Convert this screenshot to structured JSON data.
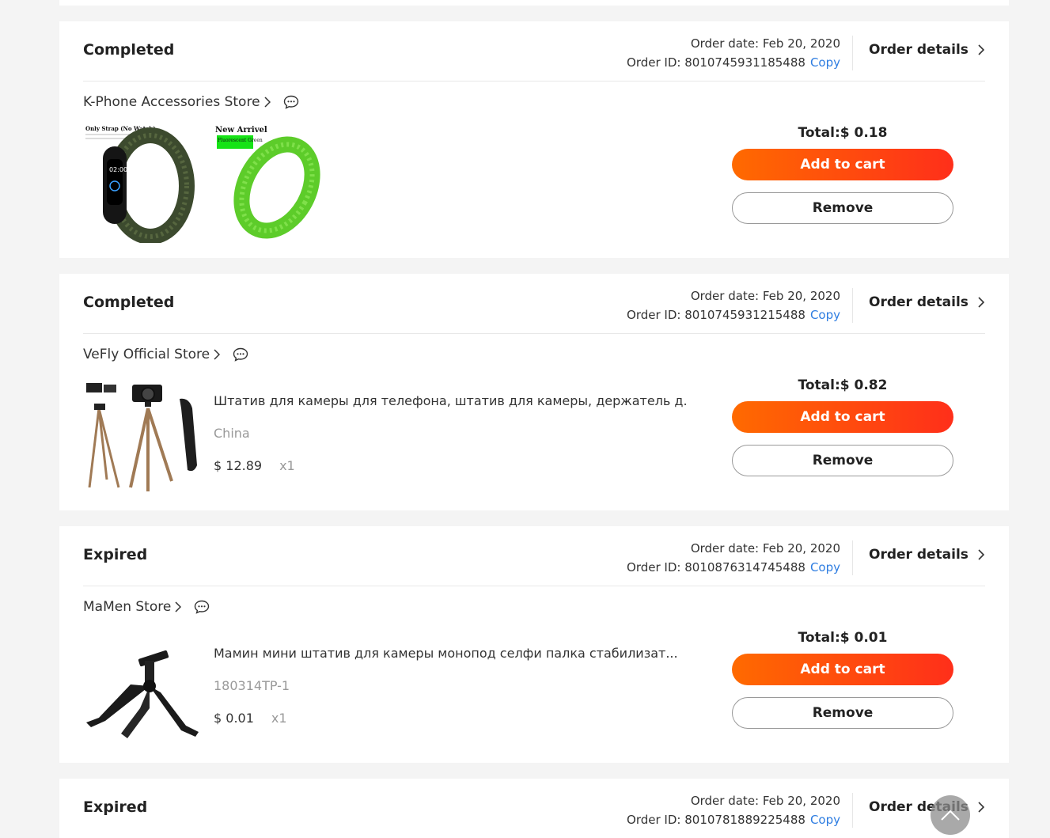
{
  "labels": {
    "order_date_prefix": "Order date: ",
    "order_id_prefix": "Order ID: ",
    "copy": "Copy",
    "order_details": "Order details",
    "total_prefix": "Total:",
    "add_to_cart": "Add to cart",
    "remove": "Remove"
  },
  "orders": [
    {
      "status": "Completed",
      "date": "Feb 20, 2020",
      "order_id": "8010745931185488",
      "store": "K-Phone Accessories Store",
      "total": "$ 0.18",
      "product_image_1_caption": "Only Strap (No Watch)",
      "product_image_2_caption": "New Arrivel",
      "product_image_2_tag": "Fluorescent Green"
    },
    {
      "status": "Completed",
      "date": "Feb 20, 2020",
      "order_id": "8010745931215488",
      "store": "VeFly Official Store",
      "total": "$ 0.82",
      "product_title": "Штатив для камеры для телефона, штатив для камеры, держатель д...",
      "sku": "China",
      "price": "$ 12.89",
      "qty": "x1"
    },
    {
      "status": "Expired",
      "date": "Feb 20, 2020",
      "order_id": "8010876314745488",
      "store": "MaMen Store",
      "total": "$ 0.01",
      "product_title": "Мамин мини штатив для камеры монопод селфи палка стабилизат...",
      "sku": "180314TP-1",
      "price": "$ 0.01",
      "qty": "x1"
    },
    {
      "status": "Expired",
      "date": "Feb 20, 2020",
      "order_id": "8010781889225488"
    }
  ],
  "icons": {
    "chevron": "chevron-right-icon",
    "chat": "chat-bubble-icon",
    "back_to_top": "chevron-up-icon"
  },
  "colors": {
    "accent_start": "#ff6a00",
    "accent_end": "#ff2f1a",
    "link": "#2e7de1"
  }
}
